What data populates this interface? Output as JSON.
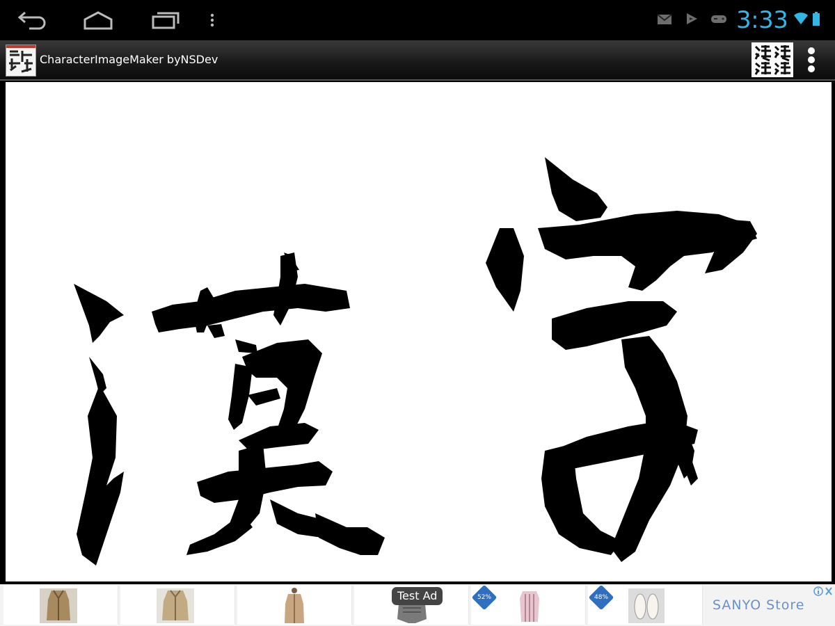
{
  "system_bar": {
    "clock": "3:33",
    "accent_color": "#33b5e5",
    "nav_icons": [
      "back-icon",
      "home-icon",
      "recents-icon",
      "menu-icon"
    ],
    "status_icons": [
      "gmail-icon",
      "play-store-icon",
      "game-controller-icon",
      "wifi-icon",
      "battery-icon"
    ]
  },
  "action_bar": {
    "app_title": "CharacterImageMaker byNSDev",
    "app_icon": "app-logo-icon",
    "action_icon": "kanji-grid-icon",
    "overflow_icon": "overflow-menu-icon"
  },
  "canvas": {
    "characters": [
      "漢",
      "字"
    ],
    "background": "#ffffff",
    "ink_color": "#000000"
  },
  "ad_banner": {
    "test_ad_label": "Test Ad",
    "discount_badges": [
      "52%",
      "48%"
    ],
    "store_logo_text": "SANYO Store",
    "products": [
      "trench-coat",
      "trench-coat",
      "long-coat",
      "shoes",
      "shirt",
      "shoes"
    ]
  }
}
